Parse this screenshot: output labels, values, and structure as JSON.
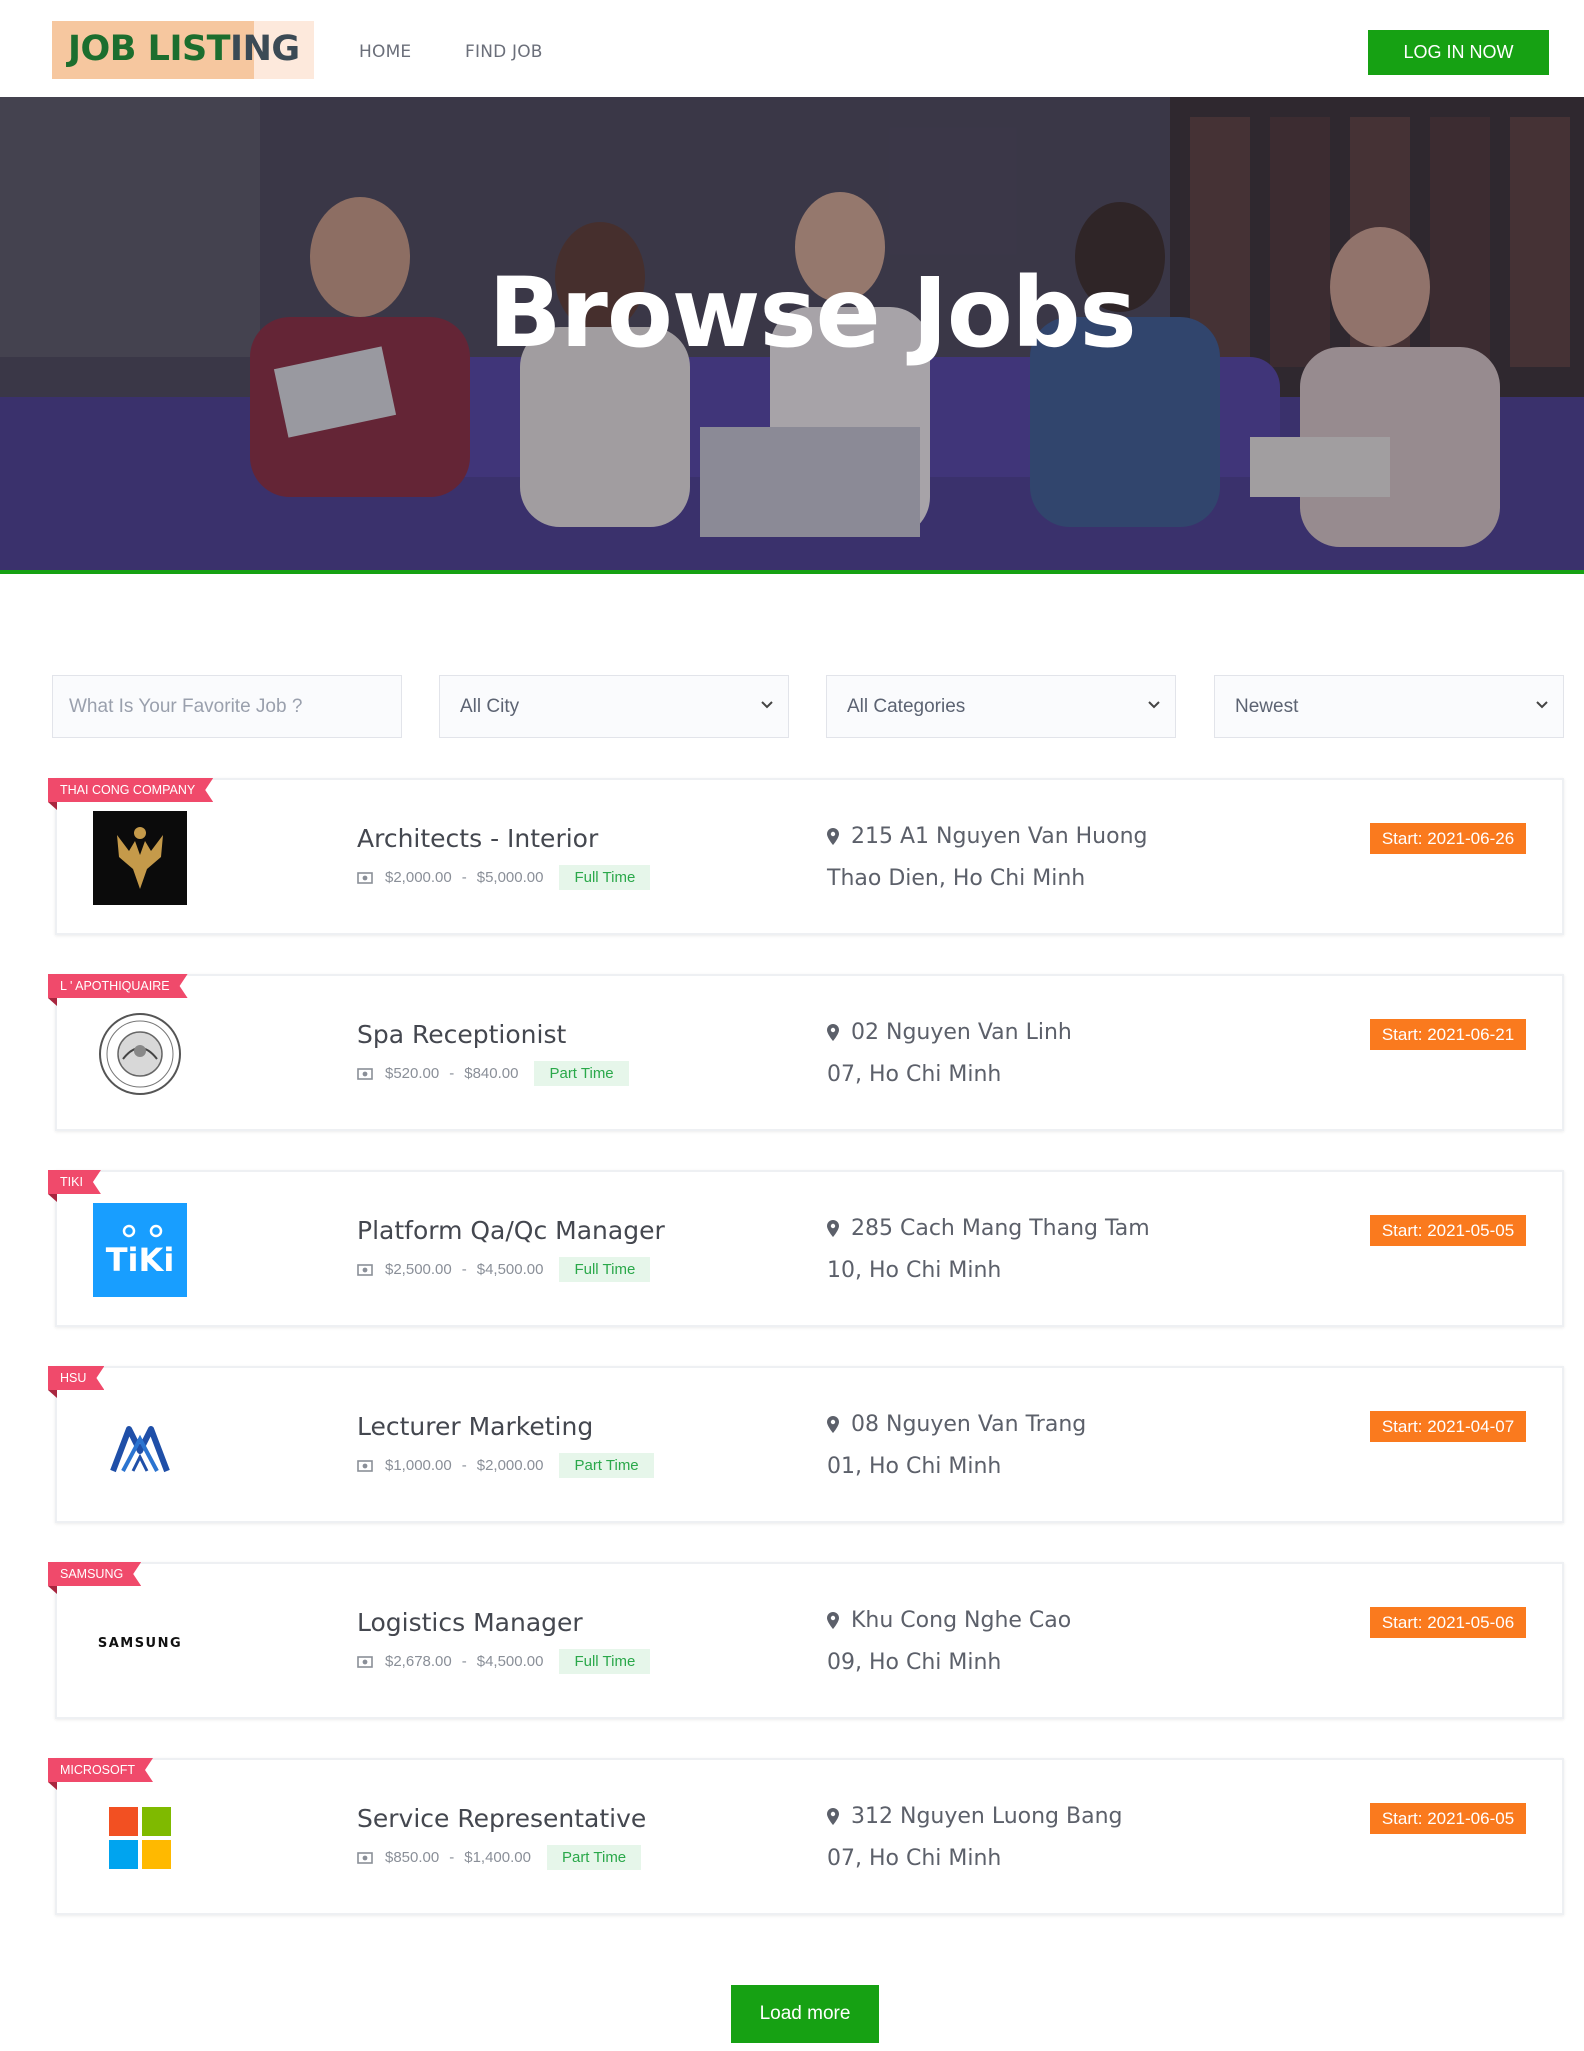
{
  "header": {
    "logo_part1": "JOB LIST",
    "logo_part2": "ING",
    "nav": [
      "HOME",
      "FIND JOB"
    ],
    "login_label": "LOG IN NOW"
  },
  "hero": {
    "title": "Browse Jobs"
  },
  "filters": {
    "search_placeholder": "What Is Your Favorite Job ?",
    "city": "All City",
    "category": "All Categories",
    "sort": "Newest"
  },
  "jobs": [
    {
      "company": "THAI CONG COMPANY",
      "title": "Architects - Interior",
      "salary_min": "$2,000.00",
      "salary_max": "$5,000.00",
      "type": "Full Time",
      "address": "215 A1 Nguyen Van Huong",
      "area": "Thao Dien, Ho Chi Minh",
      "start": "Start: 2021-06-26"
    },
    {
      "company": "L ' APOTHIQUAIRE",
      "title": "Spa Receptionist",
      "salary_min": "$520.00",
      "salary_max": "$840.00",
      "type": "Part Time",
      "address": "02 Nguyen Van Linh",
      "area": "07, Ho Chi Minh",
      "start": "Start: 2021-06-21"
    },
    {
      "company": "TIKI",
      "logo_text": "TiKi",
      "title": "Platform Qa/Qc Manager",
      "salary_min": "$2,500.00",
      "salary_max": "$4,500.00",
      "type": "Full Time",
      "address": "285 Cach Mang Thang Tam",
      "area": "10, Ho Chi Minh",
      "start": "Start: 2021-05-05"
    },
    {
      "company": "HSU",
      "title": "Lecturer Marketing",
      "salary_min": "$1,000.00",
      "salary_max": "$2,000.00",
      "type": "Part Time",
      "address": "08 Nguyen Van Trang",
      "area": "01, Ho Chi Minh",
      "start": "Start: 2021-04-07"
    },
    {
      "company": "SAMSUNG",
      "logo_text": "SAMSUNG",
      "title": "Logistics Manager",
      "salary_min": "$2,678.00",
      "salary_max": "$4,500.00",
      "type": "Full Time",
      "address": "Khu Cong Nghe Cao",
      "area": "09, Ho Chi Minh",
      "start": "Start: 2021-05-06"
    },
    {
      "company": "MICROSOFT",
      "title": "Service Representative",
      "salary_min": "$850.00",
      "salary_max": "$1,400.00",
      "type": "Part Time",
      "address": "312 Nguyen Luong Bang",
      "area": "07, Ho Chi Minh",
      "start": "Start: 2021-06-05"
    }
  ],
  "load_more_label": "Load more",
  "colors": {
    "green": "#16a113",
    "ribbon": "#f04a6b",
    "start_badge": "#fa7a1e",
    "type_bg": "#e6f6ea",
    "type_text": "#2aa84a"
  }
}
